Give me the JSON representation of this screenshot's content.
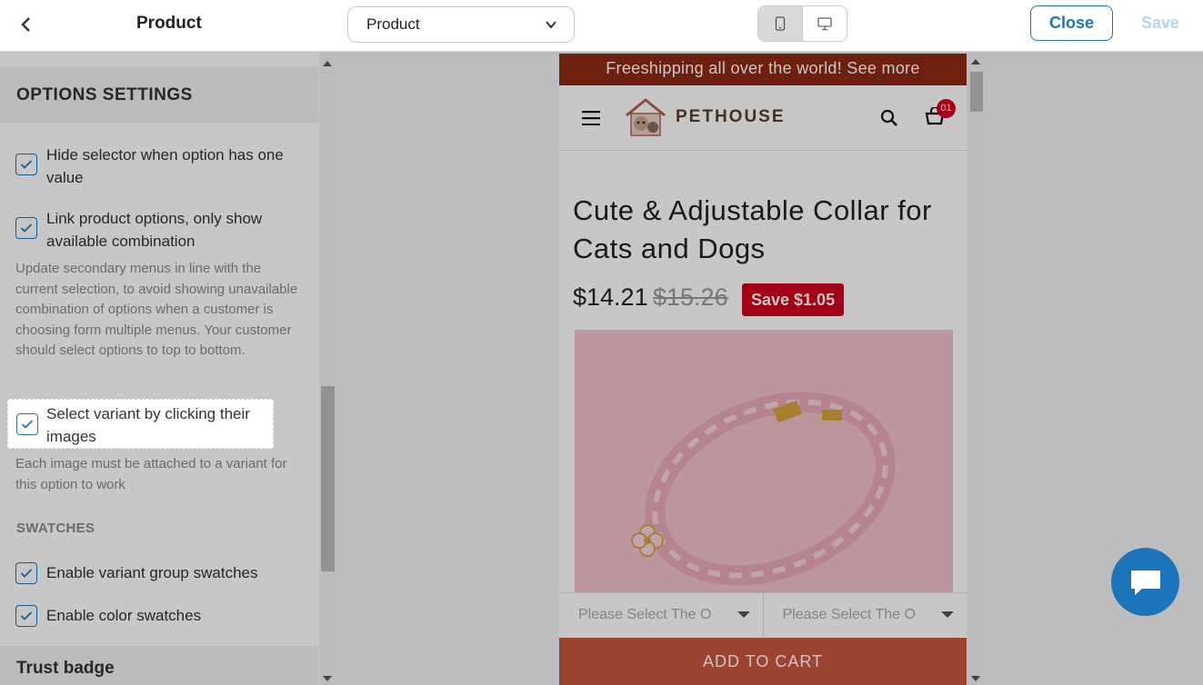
{
  "topbar": {
    "title": "Product",
    "template_select": "Product",
    "close_label": "Close",
    "save_label": "Save"
  },
  "sidebar": {
    "section_title": "OPTIONS SETTINGS",
    "options": [
      {
        "label": "Hide selector when option has one value",
        "checked": true
      },
      {
        "label": "Link product options, only show available combination",
        "checked": true,
        "help": "Update secondary menus in line with the current selection, to avoid showing unavailable combination of options when a customer is choosing form multiple menus. Your customer should select options to top to bottom."
      },
      {
        "label": "Select variant by clicking their images",
        "checked": true,
        "help": "Each image must be attached to a variant for this option to work"
      }
    ],
    "swatches_title": "SWATCHES",
    "swatches": [
      {
        "label": "Enable variant group swatches",
        "checked": true
      },
      {
        "label": "Enable color swatches",
        "checked": true
      }
    ],
    "next_section": "Trust badge"
  },
  "preview": {
    "banner": "Freeshipping all over the world! See more",
    "brand": "PETHOUSE",
    "cart_count": "01",
    "product_title": "Cute & Adjustable Collar for Cats and Dogs",
    "price": "$14.21",
    "compare_price": "$15.26",
    "save_badge": "Save $1.05",
    "variant_placeholder_1": "Please Select The O",
    "variant_placeholder_2": "Please Select The O",
    "add_to_cart": "ADD TO CART"
  },
  "colors": {
    "accent": "#1c75bb",
    "banner": "#8d2a14",
    "sale": "#d0021b",
    "add_to_cart": "#c9573f"
  }
}
